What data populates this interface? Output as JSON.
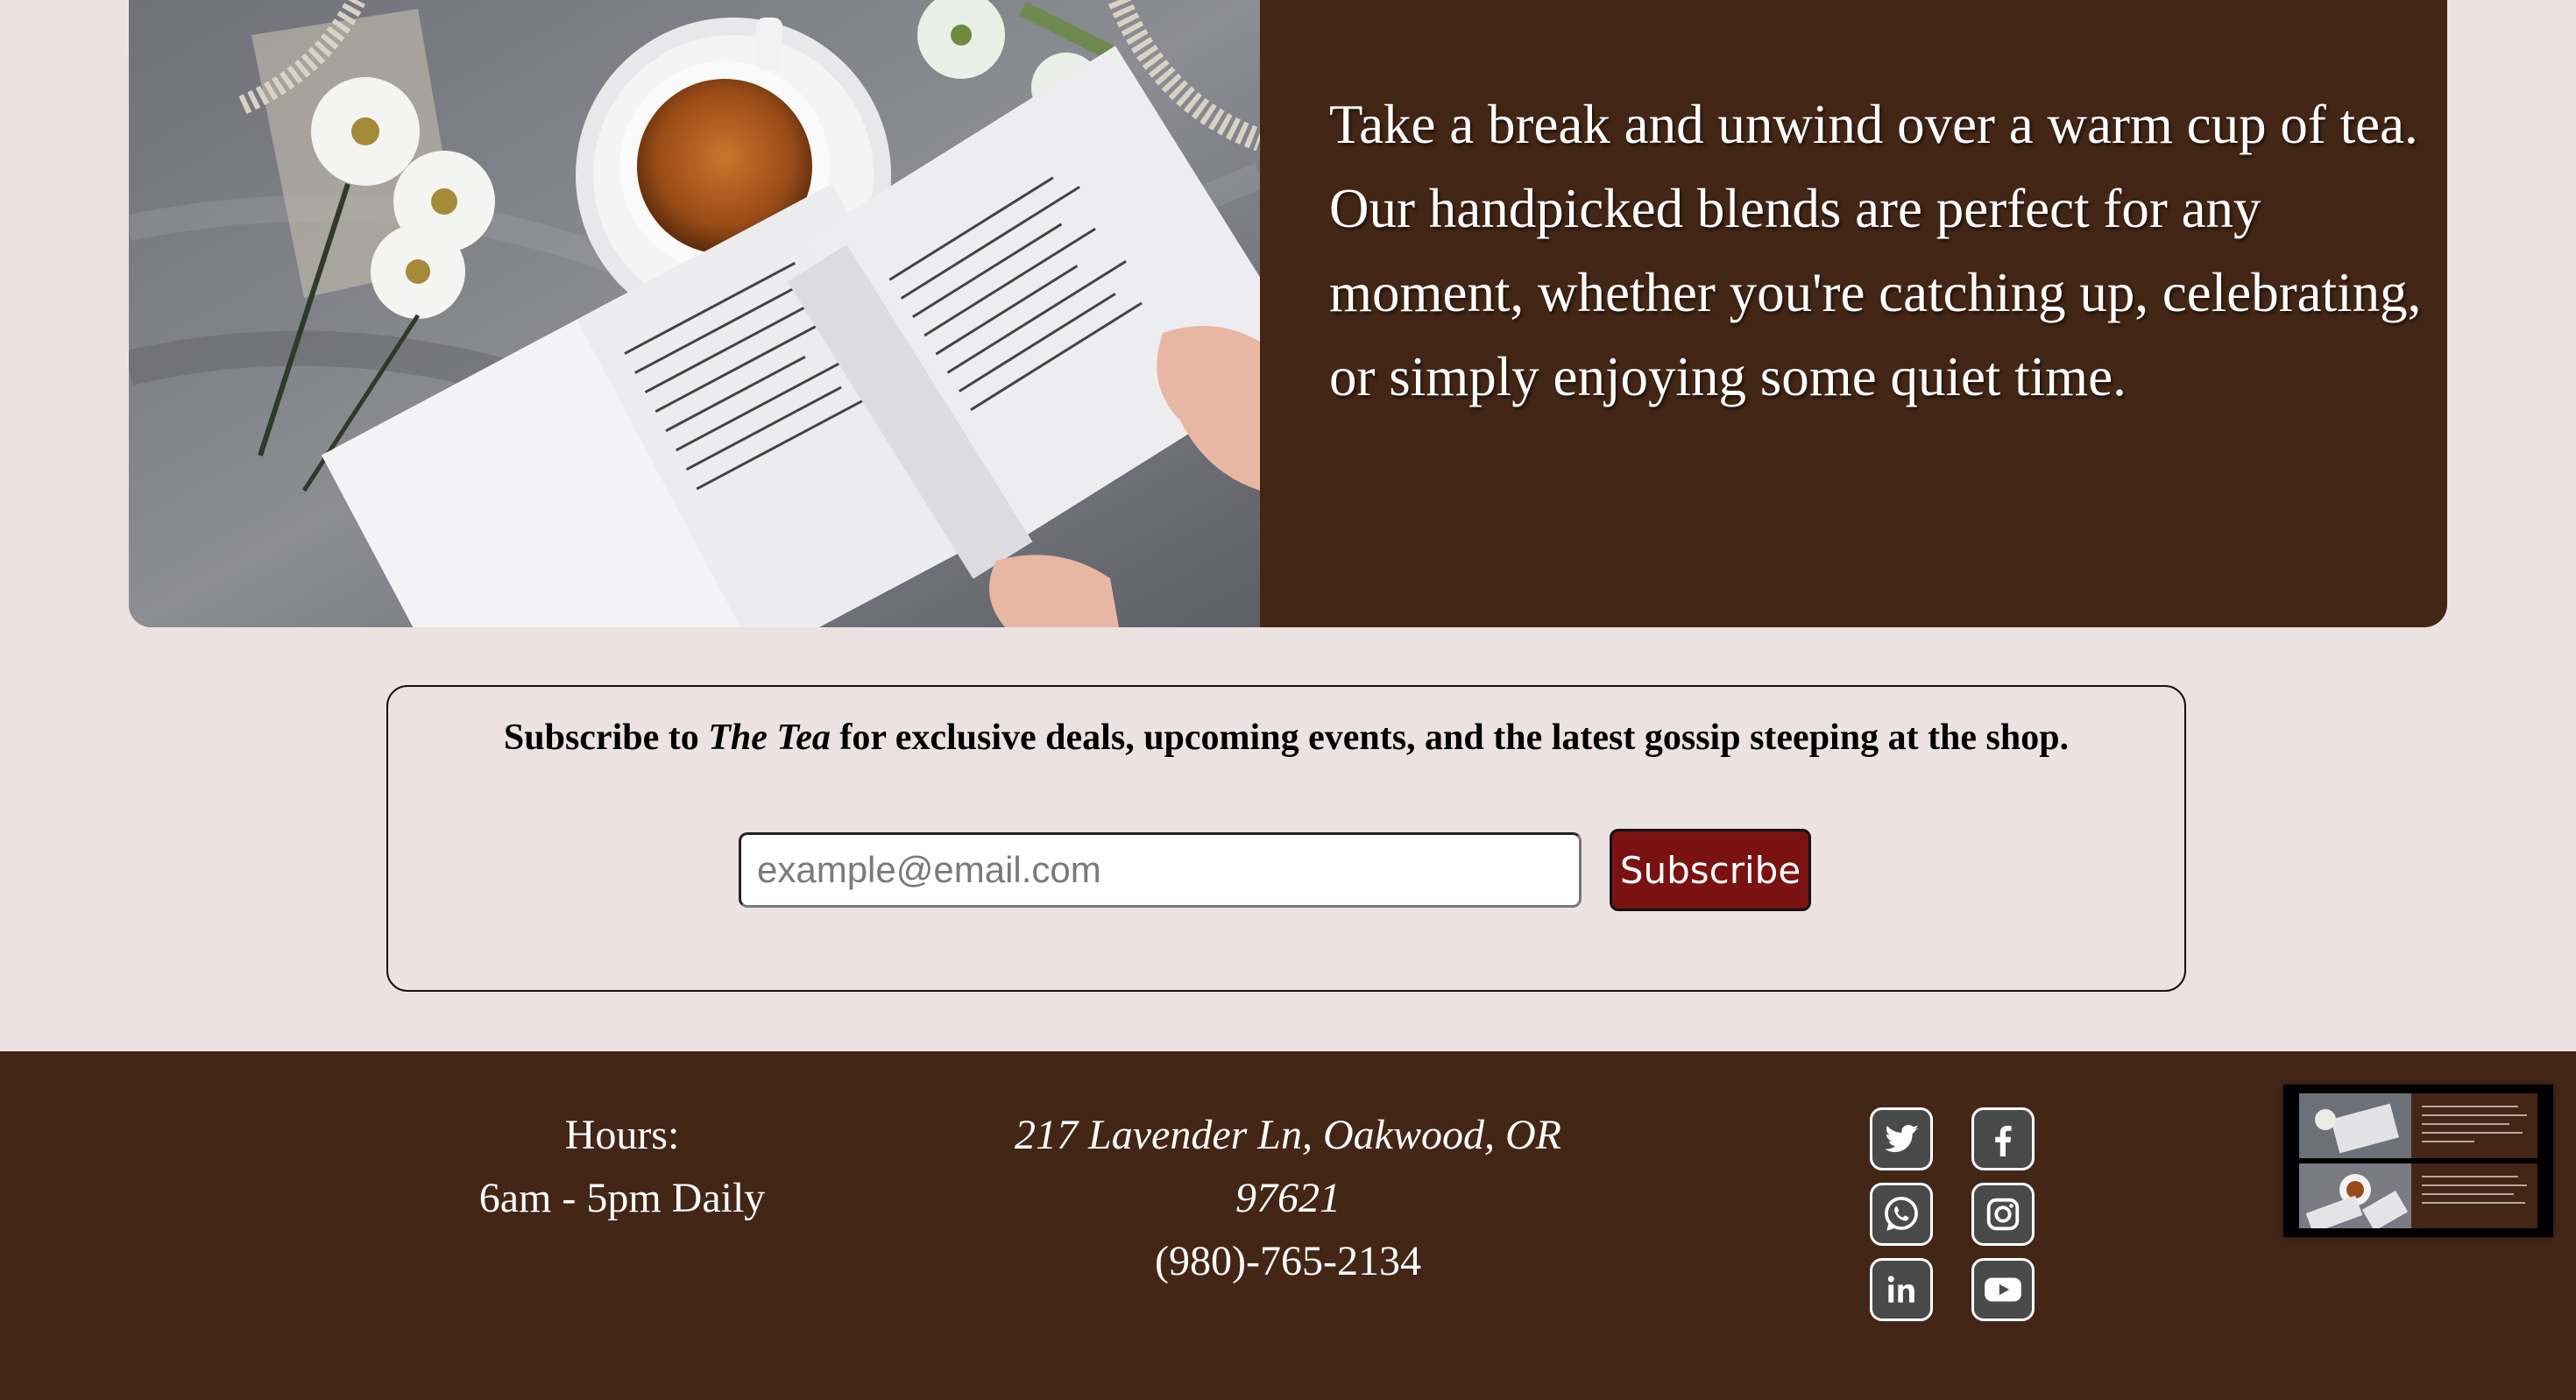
{
  "feature": {
    "paragraph": "Take a break and unwind over a warm cup of tea. Our handpicked blends are perfect for any moment, whether you're catching up, celebrating, or simply enjoying some quiet time.",
    "photo_icon": "tea-and-books-photo"
  },
  "subscribe": {
    "text_before": "Subscribe to ",
    "text_italic": "The Tea",
    "text_after": " for exclusive deals, upcoming events, and the latest gossip steeping at the shop.",
    "email_placeholder": "example@email.com",
    "email_value": "",
    "button_label": "Subscribe"
  },
  "footer": {
    "hours_label": "Hours:",
    "hours_value": "6am - 5pm Daily",
    "address_line1": "217 Lavender Ln, Oakwood, OR",
    "address_line2": "97621",
    "phone": "(980)-765-2134",
    "social": [
      {
        "name": "twitter",
        "icon": "twitter-icon"
      },
      {
        "name": "facebook",
        "icon": "facebook-icon"
      },
      {
        "name": "whatsapp",
        "icon": "whatsapp-icon"
      },
      {
        "name": "instagram",
        "icon": "instagram-icon"
      },
      {
        "name": "linkedin",
        "icon": "linkedin-icon"
      },
      {
        "name": "youtube",
        "icon": "youtube-icon"
      }
    ]
  },
  "colors": {
    "page_background": "#ece2e1",
    "brown": "#432616",
    "button_red": "#7a1212",
    "social_grey": "#4a4a4a"
  }
}
